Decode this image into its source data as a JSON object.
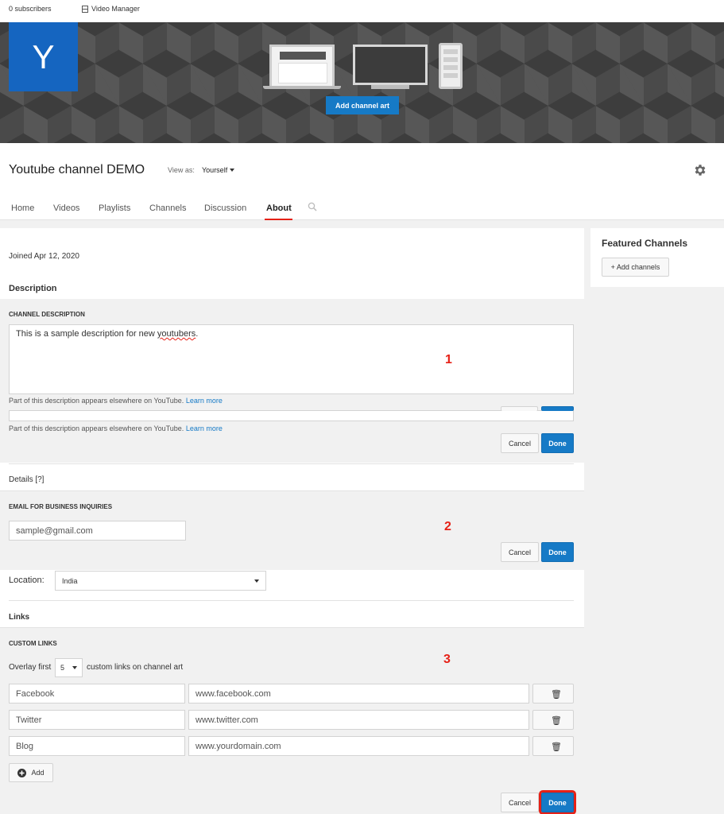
{
  "topbar": {
    "subscribers": "0 subscribers",
    "video_manager": "Video Manager"
  },
  "banner": {
    "avatar_letter": "Y",
    "add_art_label": "Add channel art"
  },
  "header": {
    "title": "Youtube channel DEMO",
    "view_as_label": "View as:",
    "view_as_value": "Yourself"
  },
  "tabs": [
    "Home",
    "Videos",
    "Playlists",
    "Channels",
    "Discussion",
    "About"
  ],
  "active_tab": "About",
  "about": {
    "joined": "Joined Apr 12, 2020",
    "description_heading": "Description",
    "channel_description_label": "CHANNEL DESCRIPTION",
    "description_text_pre": "This is a sample description for new ",
    "description_text_misspelled": "youtubers",
    "description_text_post": ".",
    "note_prefix": "Part of this description appears elsewhere on YouTube.",
    "learn_more": "Learn more",
    "cancel_label": "Cancel",
    "done_label": "Done",
    "details_heading": "Details [?]",
    "email_label": "EMAIL FOR BUSINESS INQUIRIES",
    "email_value": "sample@gmail.com",
    "location_label": "Location:",
    "location_value": "India",
    "links_heading": "Links",
    "custom_links_label": "CUSTOM LINKS",
    "overlay_prefix": "Overlay first",
    "overlay_count": "5",
    "overlay_suffix": "custom links on channel art",
    "links": [
      {
        "title": "Facebook",
        "url": "www.facebook.com"
      },
      {
        "title": "Twitter",
        "url": "www.twitter.com"
      },
      {
        "title": "Blog",
        "url": "www.yourdomain.com"
      }
    ],
    "add_label": "Add"
  },
  "markers": [
    "1",
    "2",
    "3"
  ],
  "featured": {
    "title": "Featured Channels",
    "add_label": "+ Add channels"
  },
  "colors": {
    "accent": "#167ac6",
    "brand_red": "#e62117",
    "avatar_bg": "#1565c0"
  }
}
